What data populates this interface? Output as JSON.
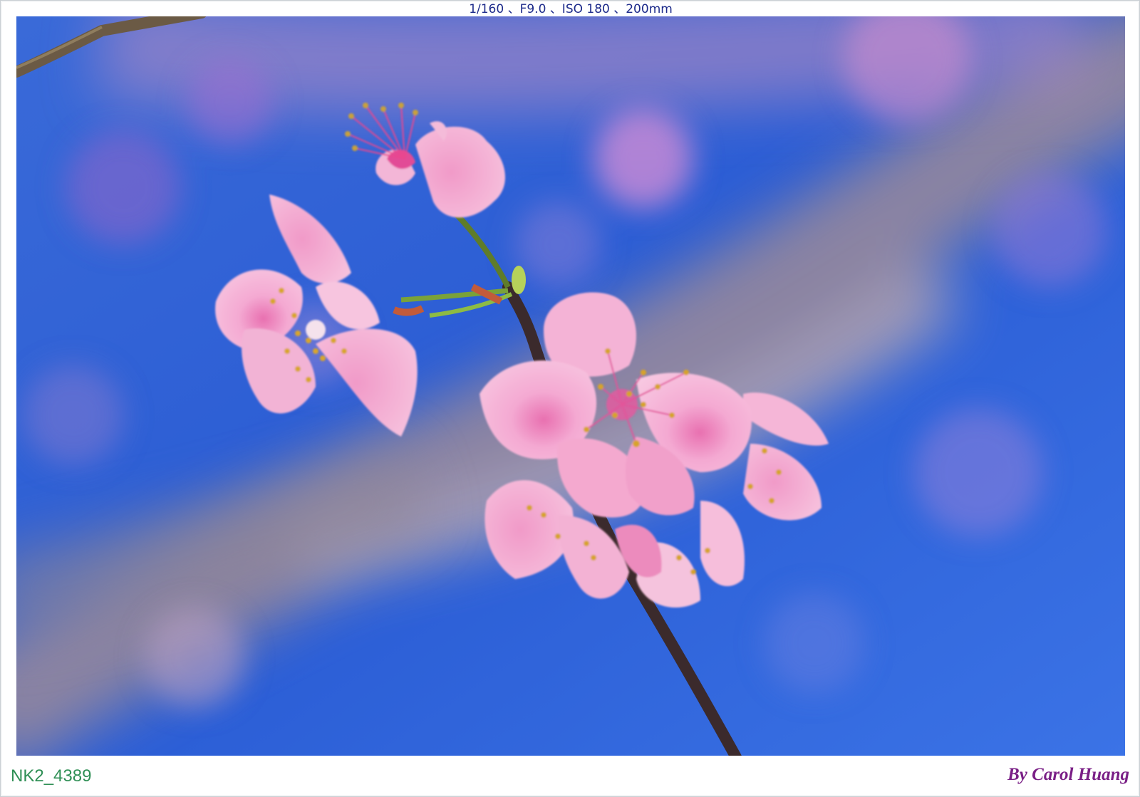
{
  "caption": {
    "exif": "1/160 、F9.0 、ISO 180 、200mm",
    "file_id": "NK2_4389",
    "credit": "By Carol Huang"
  },
  "colors": {
    "sky": "#2f5fd0",
    "blossom": "#f2a6cf",
    "branch": "#4a3030",
    "file_id_text": "#2f8f55",
    "credit_text": "#7a1f86"
  }
}
